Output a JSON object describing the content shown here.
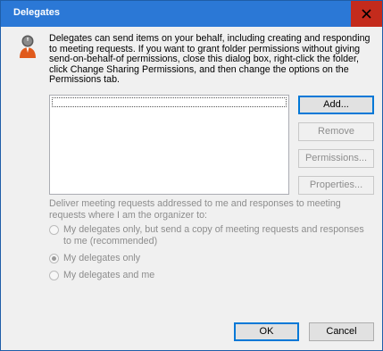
{
  "window": {
    "title": "Delegates",
    "close_icon": "close-icon"
  },
  "icons": {
    "delegates": "person-icon"
  },
  "description": "Delegates can send items on your behalf, including creating and responding to meeting requests. If you want to grant folder permissions without giving send-on-behalf-of permissions, close this dialog box, right-click the folder, click Change Sharing Permissions, and then change the options on the Permissions tab.",
  "delegate_list": [],
  "buttons": {
    "add": "Add...",
    "remove": "Remove",
    "permissions": "Permissions...",
    "properties": "Properties...",
    "ok": "OK",
    "cancel": "Cancel"
  },
  "deliver_label": "Deliver meeting requests addressed to me and responses to meeting requests where I am the organizer to:",
  "delivery_options": [
    {
      "label": "My delegates only, but send a copy of meeting requests and responses to me (recommended)",
      "selected": false
    },
    {
      "label": "My delegates only",
      "selected": true
    },
    {
      "label": "My delegates and me",
      "selected": false
    }
  ]
}
